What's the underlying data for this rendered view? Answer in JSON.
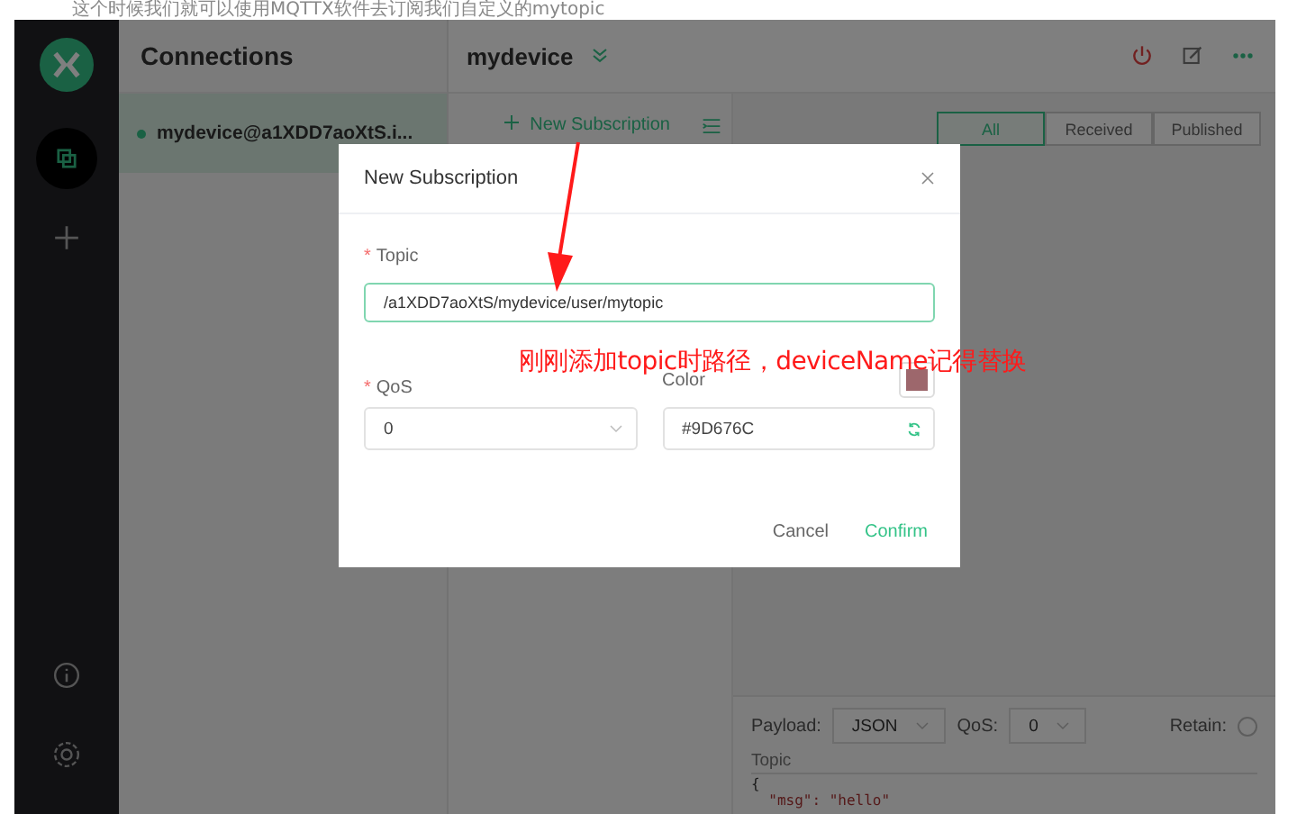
{
  "caption": "这个时候我们就可以使用MQTTX软件去订阅我们自定义的mytopic",
  "rail": {
    "items": [
      {
        "kind": "connections",
        "selected": true
      },
      {
        "kind": "add",
        "selected": false
      }
    ],
    "bottom": [
      {
        "kind": "about"
      },
      {
        "kind": "settings"
      }
    ]
  },
  "connections": {
    "title": "Connections",
    "items": [
      {
        "name": "mydevice@a1XDD7aoXtS.i...",
        "selected": true
      }
    ]
  },
  "main": {
    "title": "mydevice",
    "new_subscription": "New Subscription",
    "filter_tabs": [
      {
        "label": "All",
        "selected": true
      },
      {
        "label": "Received",
        "selected": false
      },
      {
        "label": "Published",
        "selected": false
      }
    ],
    "composer": {
      "payload_label": "Payload:",
      "payload_format": "JSON",
      "qos_label": "QoS:",
      "qos": "0",
      "retain_label": "Retain:",
      "retain": false,
      "topic_placeholder": "Topic",
      "code_lines": [
        "{",
        "  \"msg\": \"hello\""
      ]
    }
  },
  "dialog": {
    "title": "New Subscription",
    "required_mark": "*",
    "topic_label": "Topic",
    "topic_value": "/a1XDD7aoXtS/mydevice/user/mytopic",
    "qos_label": "QoS",
    "qos_value": "0",
    "color_label": "Color",
    "color_value": "#9D676C",
    "buttons": [
      {
        "kind": "cancel",
        "label": "Cancel"
      },
      {
        "kind": "confirm",
        "label": "Confirm"
      }
    ]
  },
  "annotation": {
    "text": "刚刚添加topic时路径，deviceName记得替换"
  }
}
